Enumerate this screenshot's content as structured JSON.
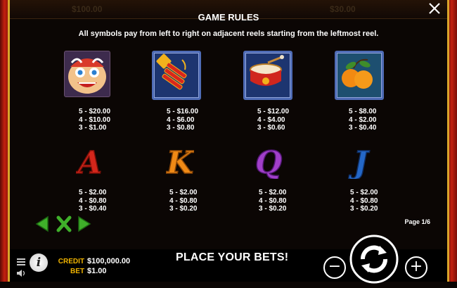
{
  "background_ghost": {
    "credit_top": "$100.00",
    "bet_top": "$30.00"
  },
  "rules": {
    "title": "GAME RULES",
    "description": "All symbols pay from left to right on adjacent reels starting from the leftmost reel.",
    "page": "Page 1/6"
  },
  "symbols_row1": [
    {
      "icon": "lion-dance-head-icon",
      "pays": [
        "5 - $20.00",
        "4 - $10.00",
        "3 - $1.00"
      ]
    },
    {
      "icon": "firecrackers-icon",
      "pays": [
        "5 - $16.00",
        "4 - $6.00",
        "3 - $0.80"
      ]
    },
    {
      "icon": "drum-icon",
      "pays": [
        "5 - $12.00",
        "4 - $4.00",
        "3 - $0.60"
      ]
    },
    {
      "icon": "mandarin-oranges-icon",
      "pays": [
        "5 - $8.00",
        "4 - $2.00",
        "3 - $0.40"
      ]
    }
  ],
  "symbols_row2": [
    {
      "letter": "A",
      "pays": [
        "5 - $2.00",
        "4 - $0.80",
        "3 - $0.40"
      ]
    },
    {
      "letter": "K",
      "pays": [
        "5 - $2.00",
        "4 - $0.80",
        "3 - $0.20"
      ]
    },
    {
      "letter": "Q",
      "pays": [
        "5 - $2.00",
        "4 - $0.80",
        "3 - $0.20"
      ]
    },
    {
      "letter": "J",
      "pays": [
        "5 - $2.00",
        "4 - $0.80",
        "3 - $0.20"
      ]
    }
  ],
  "status": {
    "credit_label": "CREDIT",
    "credit_value": "$100,000.00",
    "bet_label": "BET",
    "bet_value": "$1.00",
    "message": "PLACE YOUR BETS!"
  },
  "colors": {
    "accent_gold": "#f0b400",
    "nav_green": "#3fb02a",
    "letter_red": "#d4261b",
    "letter_orange": "#f08a16",
    "letter_purple": "#a13fc9",
    "letter_blue": "#2467c7"
  }
}
